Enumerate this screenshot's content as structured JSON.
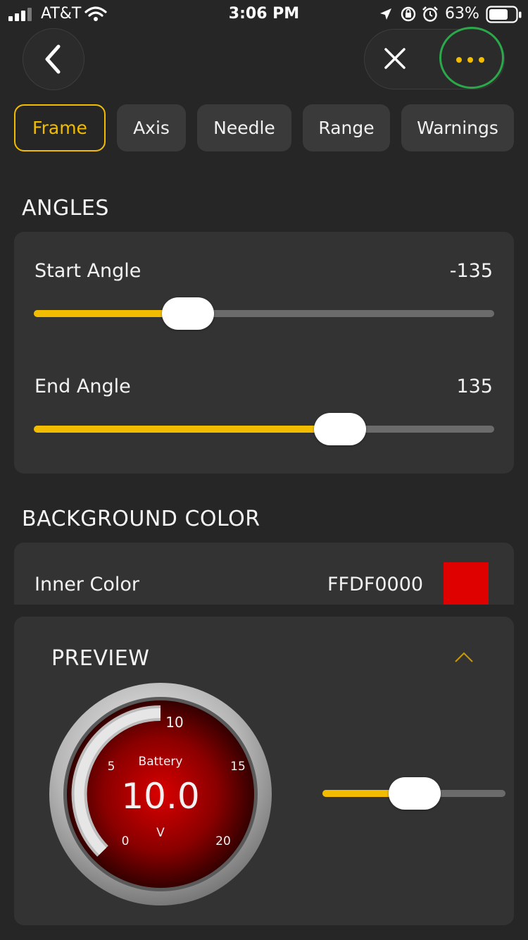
{
  "status_bar": {
    "carrier": "AT&T",
    "time": "3:06 PM",
    "battery": "63%"
  },
  "tabs": [
    {
      "label": "Frame",
      "active": true
    },
    {
      "label": "Axis",
      "active": false
    },
    {
      "label": "Needle",
      "active": false
    },
    {
      "label": "Range",
      "active": false
    },
    {
      "label": "Warnings",
      "active": false
    }
  ],
  "angles": {
    "title": "ANGLES",
    "start": {
      "label": "Start Angle",
      "value": "-135",
      "fraction": 0.33
    },
    "end": {
      "label": "End Angle",
      "value": "135",
      "fraction": 0.66
    }
  },
  "background_color": {
    "title": "BACKGROUND COLOR",
    "inner": {
      "label": "Inner Color",
      "value": "FFDF0000",
      "swatch": "#DF0000"
    }
  },
  "preview": {
    "title": "PREVIEW",
    "gauge": {
      "name": "Battery",
      "reading": "10.0",
      "unit": "V",
      "ticks": [
        "0",
        "5",
        "10",
        "15",
        "20"
      ]
    },
    "slider_fraction": 0.5
  },
  "colors": {
    "accent": "#F2BD00",
    "background": "#262626",
    "card": "#333333"
  }
}
